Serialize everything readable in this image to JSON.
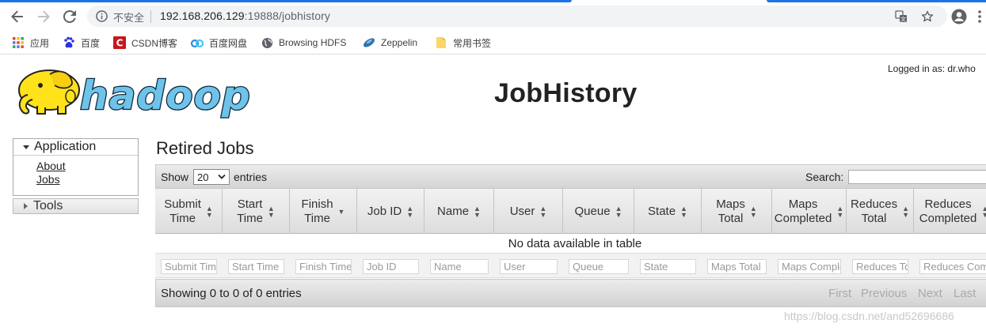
{
  "browser": {
    "security_label": "不安全",
    "url_host": "192.168.206.129",
    "url_rest": ":19888/jobhistory",
    "bookmarks": [
      {
        "label": "应用",
        "icon": "apps-grid-icon"
      },
      {
        "label": "百度",
        "icon": "baidu-paw-icon"
      },
      {
        "label": "CSDN博客",
        "icon": "csdn-icon"
      },
      {
        "label": "百度网盘",
        "icon": "baidu-netdisk-icon"
      },
      {
        "label": "Browsing HDFS",
        "icon": "globe-icon"
      },
      {
        "label": "Zeppelin",
        "icon": "zeppelin-icon"
      },
      {
        "label": "常用书签",
        "icon": "folder-icon"
      }
    ]
  },
  "header": {
    "title": "JobHistory",
    "logged_in": "Logged in as: dr.who",
    "logo_text": "hadoop"
  },
  "sidebar": {
    "application_label": "Application",
    "links": [
      "About",
      "Jobs"
    ],
    "tools_label": "Tools"
  },
  "main": {
    "section_title": "Retired Jobs",
    "length_label_before": "Show",
    "length_value": "20",
    "length_label_after": "entries",
    "search_label": "Search:",
    "columns": [
      [
        "Submit",
        "Time"
      ],
      [
        "Start",
        "Time"
      ],
      [
        "Finish",
        "Time"
      ],
      [
        "Job ID"
      ],
      [
        "Name"
      ],
      [
        "User"
      ],
      [
        "Queue"
      ],
      [
        "State"
      ],
      [
        "Maps",
        "Total"
      ],
      [
        "Maps",
        "Completed"
      ],
      [
        "Reduces",
        "Total"
      ],
      [
        "Reduces",
        "Completed"
      ]
    ],
    "empty_message": "No data available in table",
    "filters": [
      "Submit Time",
      "Start Time",
      "Finish Time",
      "Job ID",
      "Name",
      "User",
      "Queue",
      "State",
      "Maps Total",
      "Maps Completed",
      "Reduces Total",
      "Reduces Completed"
    ],
    "info": "Showing 0 to 0 of 0 entries",
    "pagination": [
      "First",
      "Previous",
      "Next",
      "Last"
    ]
  },
  "watermark": "https://blog.csdn.net/and52696686",
  "colors": {
    "accent": "#1a73e8",
    "logo_yellow": "#ffe21a",
    "logo_blue": "#6fc3e8"
  }
}
